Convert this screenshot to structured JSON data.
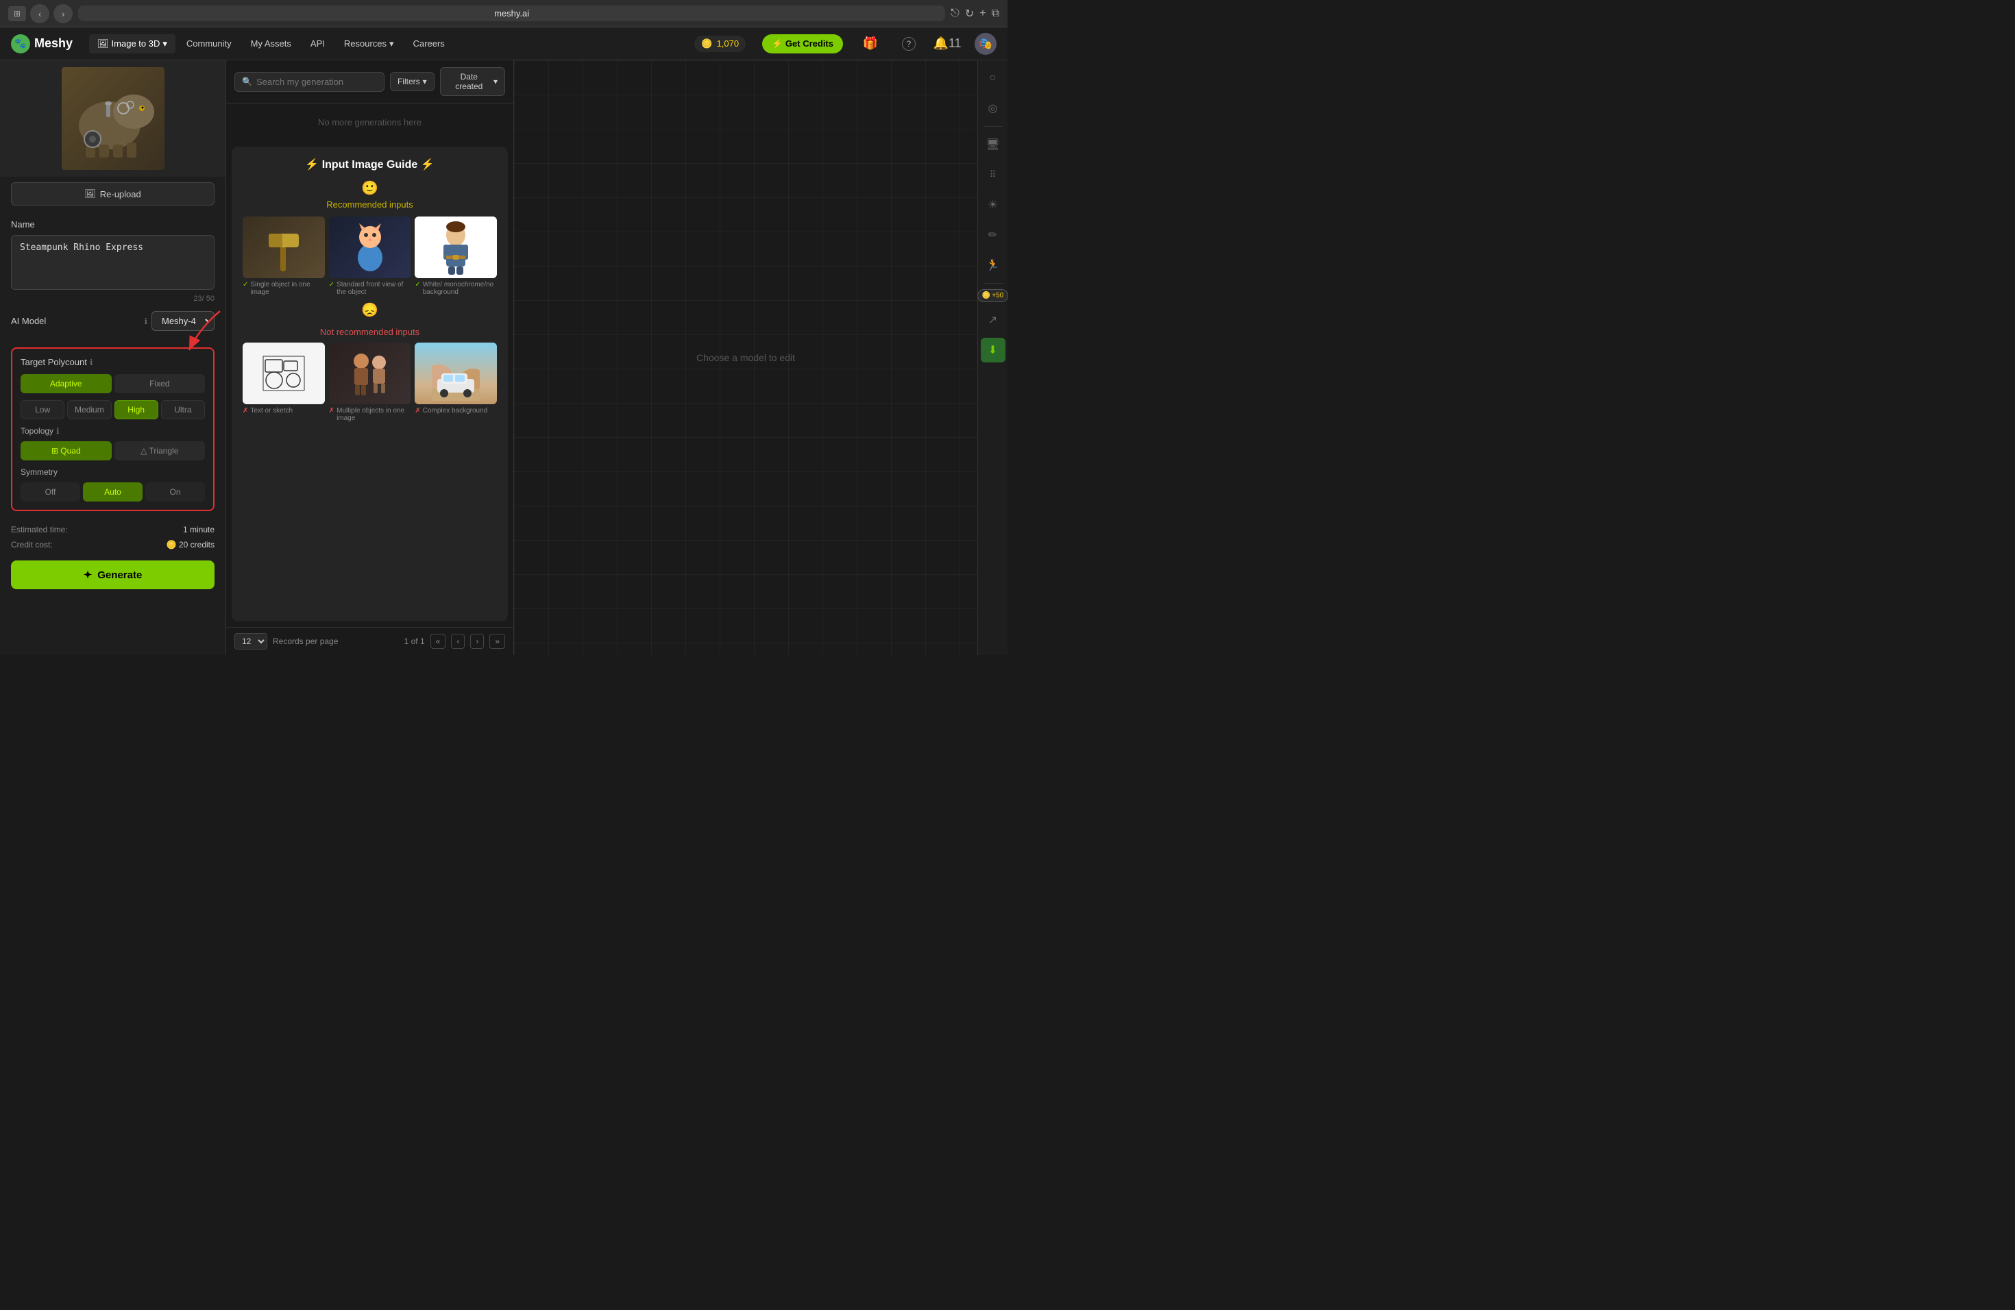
{
  "browser": {
    "url": "meshy.ai",
    "back_label": "‹",
    "forward_label": "›",
    "reload_label": "↻",
    "share_label": "⎋",
    "newtab_label": "+",
    "tabs_label": "⧉"
  },
  "nav": {
    "logo": "Meshy",
    "logo_emoji": "🐾",
    "items": [
      {
        "label": "Image to 3D",
        "active": true,
        "icon": "🖼"
      },
      {
        "label": "Community",
        "active": false
      },
      {
        "label": "My Assets",
        "active": false
      },
      {
        "label": "API",
        "active": false
      },
      {
        "label": "Resources",
        "active": false
      },
      {
        "label": "Careers",
        "active": false
      }
    ],
    "credits": "1,070",
    "credits_icon": "🪙",
    "get_credits_label": "⚡ Get Credits",
    "gift_icon": "🎁",
    "help_icon": "?",
    "notification_count": "11",
    "avatar_icon": "👤"
  },
  "sidebar": {
    "thumbnail_emoji": "🦏",
    "reupload_label": "Re-upload",
    "name_label": "Name",
    "name_value": "Steampunk Rhino Express",
    "char_count": "23/ 50",
    "ai_model_label": "AI Model",
    "ai_model_info": "ℹ",
    "ai_model_value": "Meshy-4",
    "polycount_label": "Target Polycount",
    "polycount_info": "ℹ",
    "adaptive_label": "Adaptive",
    "fixed_label": "Fixed",
    "low_label": "Low",
    "medium_label": "Medium",
    "high_label": "High",
    "ultra_label": "Ultra",
    "topology_label": "Topology",
    "topology_info": "ℹ",
    "quad_label": "Quad",
    "quad_icon": "⊞",
    "triangle_label": "Triangle",
    "triangle_icon": "△",
    "symmetry_label": "Symmetry",
    "off_label": "Off",
    "auto_label": "Auto",
    "on_label": "On",
    "estimated_time_label": "Estimated time:",
    "estimated_time_value": "1 minute",
    "credit_cost_label": "Credit cost:",
    "credit_cost_value": "20 credits",
    "generate_label": "Generate",
    "generate_icon": "✦"
  },
  "middle": {
    "search_placeholder": "Search my generation",
    "filters_label": "Filters",
    "date_created_label": "Date created",
    "no_more_label": "No more generations here",
    "guide_title": "⚡ Input Image Guide ⚡",
    "recommended_title": "Recommended inputs",
    "recommended_icon": "🙂",
    "not_recommended_title": "Not recommended inputs",
    "not_recommended_icon": "😞",
    "recommended_items": [
      {
        "caption": "Single object in one image",
        "check": "✓",
        "emoji": "🔨"
      },
      {
        "caption": "Standard front view of the object",
        "check": "✓",
        "emoji": "🐱"
      },
      {
        "caption": "White/ monochrome/no background",
        "check": "✓",
        "emoji": "👤"
      }
    ],
    "not_recommended_items": [
      {
        "caption": "Text or sketch",
        "check": "✗",
        "emoji": "⚙"
      },
      {
        "caption": "Multiple objects in one image",
        "check": "✗",
        "emoji": "👥"
      },
      {
        "caption": "Complex background",
        "check": "✗",
        "emoji": "🚙"
      }
    ],
    "pagination": {
      "per_page": "12",
      "records_label": "Records per page",
      "page_info": "1 of 1",
      "first_label": "«",
      "prev_label": "‹",
      "next_label": "›",
      "last_label": "»"
    }
  },
  "right": {
    "choose_model_text": "Choose a model to edit"
  },
  "toolbar_right": {
    "icons": [
      "○",
      "○",
      "—",
      "🖥",
      "///",
      "☀",
      "✏",
      "🏃"
    ],
    "credits_badge": "+50",
    "share_icon": "↗",
    "download_icon": "⬇"
  }
}
